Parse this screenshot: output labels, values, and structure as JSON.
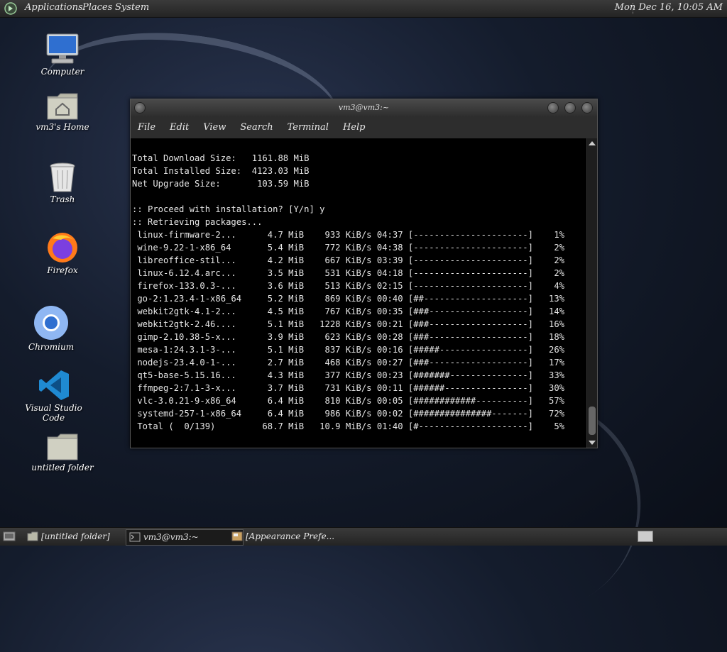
{
  "top_panel": {
    "menus": [
      "Applications",
      "Places",
      "System"
    ],
    "clock": "Mon Dec 16, 10:05 AM"
  },
  "desktop_icons": [
    {
      "label": "Computer",
      "icon": "computer-icon"
    },
    {
      "label": "vm3's Home",
      "icon": "home-folder-icon"
    },
    {
      "label": "Trash",
      "icon": "trash-icon"
    },
    {
      "label": "Firefox",
      "icon": "firefox-icon"
    },
    {
      "label": "Chromium",
      "icon": "chromium-icon"
    },
    {
      "label": "Visual Studio Code",
      "icon": "vscode-icon"
    },
    {
      "label": "untitled folder",
      "icon": "folder-icon"
    }
  ],
  "terminal": {
    "title": "vm3@vm3:~",
    "menu": [
      "File",
      "Edit",
      "View",
      "Search",
      "Terminal",
      "Help"
    ],
    "summary": [
      "Total Download Size:   1161.88 MiB",
      "Total Installed Size:  4123.03 MiB",
      "Net Upgrade Size:       103.59 MiB",
      "",
      ":: Proceed with installation? [Y/n] y",
      ":: Retrieving packages..."
    ],
    "downloads": [
      {
        "name": "linux-firmware-2...",
        "size": "4.7 MiB",
        "rate": "933 KiB/s",
        "eta": "04:37",
        "bar": "[----------------------]",
        "percent": "1%"
      },
      {
        "name": "wine-9.22-1-x86_64",
        "size": "5.4 MiB",
        "rate": "772 KiB/s",
        "eta": "04:38",
        "bar": "[----------------------]",
        "percent": "2%"
      },
      {
        "name": "libreoffice-stil...",
        "size": "4.2 MiB",
        "rate": "667 KiB/s",
        "eta": "03:39",
        "bar": "[----------------------]",
        "percent": "2%"
      },
      {
        "name": "linux-6.12.4.arc...",
        "size": "3.5 MiB",
        "rate": "531 KiB/s",
        "eta": "04:18",
        "bar": "[----------------------]",
        "percent": "2%"
      },
      {
        "name": "firefox-133.0.3-...",
        "size": "3.6 MiB",
        "rate": "513 KiB/s",
        "eta": "02:15",
        "bar": "[----------------------]",
        "percent": "4%"
      },
      {
        "name": "go-2:1.23.4-1-x86_64",
        "size": "5.2 MiB",
        "rate": "869 KiB/s",
        "eta": "00:40",
        "bar": "[##--------------------]",
        "percent": "13%"
      },
      {
        "name": "webkit2gtk-4.1-2...",
        "size": "4.5 MiB",
        "rate": "767 KiB/s",
        "eta": "00:35",
        "bar": "[###-------------------]",
        "percent": "14%"
      },
      {
        "name": "webkit2gtk-2.46....",
        "size": "5.1 MiB",
        "rate": "1228 KiB/s",
        "eta": "00:21",
        "bar": "[###-------------------]",
        "percent": "16%"
      },
      {
        "name": "gimp-2.10.38-5-x...",
        "size": "3.9 MiB",
        "rate": "623 KiB/s",
        "eta": "00:28",
        "bar": "[###-------------------]",
        "percent": "18%"
      },
      {
        "name": "mesa-1:24.3.1-3-...",
        "size": "5.1 MiB",
        "rate": "837 KiB/s",
        "eta": "00:16",
        "bar": "[#####-----------------]",
        "percent": "26%"
      },
      {
        "name": "nodejs-23.4.0-1-...",
        "size": "2.7 MiB",
        "rate": "468 KiB/s",
        "eta": "00:27",
        "bar": "[###-------------------]",
        "percent": "17%"
      },
      {
        "name": "qt5-base-5.15.16...",
        "size": "4.3 MiB",
        "rate": "377 KiB/s",
        "eta": "00:23",
        "bar": "[#######---------------]",
        "percent": "33%"
      },
      {
        "name": "ffmpeg-2:7.1-3-x...",
        "size": "3.7 MiB",
        "rate": "731 KiB/s",
        "eta": "00:11",
        "bar": "[######----------------]",
        "percent": "30%"
      },
      {
        "name": "vlc-3.0.21-9-x86_64",
        "size": "6.4 MiB",
        "rate": "810 KiB/s",
        "eta": "00:05",
        "bar": "[############----------]",
        "percent": "57%"
      },
      {
        "name": "systemd-257-1-x86_64",
        "size": "6.4 MiB",
        "rate": "986 KiB/s",
        "eta": "00:02",
        "bar": "[###############-------]",
        "percent": "72%"
      },
      {
        "name": "Total (  0/139)",
        "size": "68.7 MiB",
        "rate": "10.9 MiB/s",
        "eta": "01:40",
        "bar": "[#---------------------]",
        "percent": "5%"
      }
    ]
  },
  "taskbar": {
    "tasks": [
      {
        "label": "[untitled folder]",
        "icon": "folder-icon",
        "active": false
      },
      {
        "label": "vm3@vm3:~",
        "icon": "terminal-icon",
        "active": true
      },
      {
        "label": "[Appearance Prefe...",
        "icon": "appearance-icon",
        "active": false
      }
    ]
  },
  "colors": {
    "panel": "#2e2e2e",
    "terminal_bg": "#000000",
    "terminal_fg": "#e6e6e6",
    "desktop_bg": "#141c2c"
  }
}
